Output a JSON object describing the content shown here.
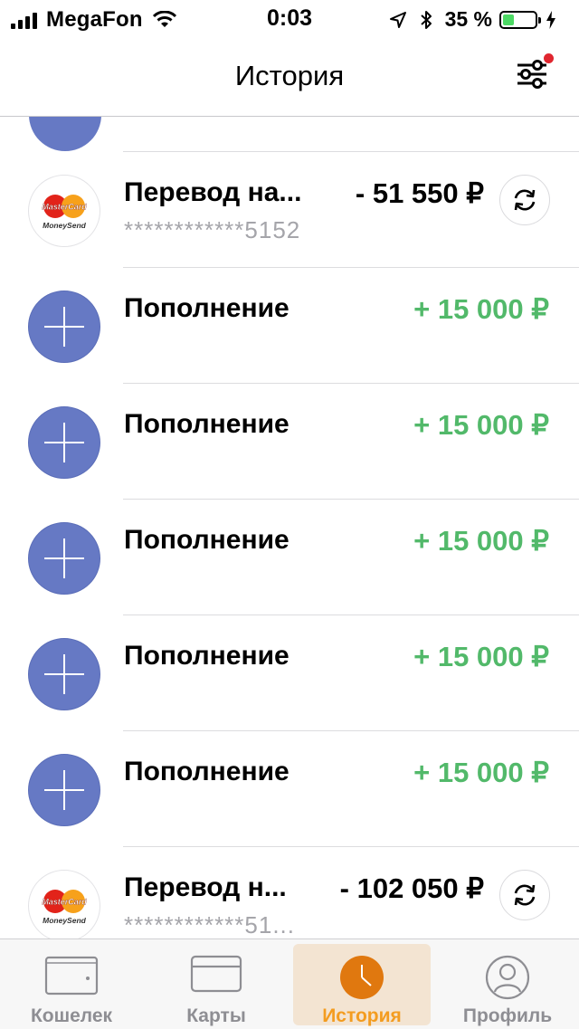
{
  "status_bar": {
    "carrier": "MegaFon",
    "time": "0:03",
    "battery_percent": "35 %",
    "battery_level": 0.35
  },
  "navbar": {
    "title": "История"
  },
  "transactions": [
    {
      "type": "transfer",
      "title": "Перевод на...",
      "subtitle": "************5152",
      "amount": "- 51 550 ₽"
    },
    {
      "type": "topup",
      "title": "Пополнение",
      "amount": "+ 15 000 ₽"
    },
    {
      "type": "topup",
      "title": "Пополнение",
      "amount": "+ 15 000 ₽"
    },
    {
      "type": "topup",
      "title": "Пополнение",
      "amount": "+ 15 000 ₽"
    },
    {
      "type": "topup",
      "title": "Пополнение",
      "amount": "+ 15 000 ₽"
    },
    {
      "type": "topup",
      "title": "Пополнение",
      "amount": "+ 15 000 ₽"
    },
    {
      "type": "transfer",
      "title": "Перевод н...",
      "subtitle": "************51...",
      "amount": "- 102 050 ₽"
    }
  ],
  "mastercard_logo": {
    "brand": "MasterCard",
    "sub": "MoneySend"
  },
  "tabs": [
    {
      "label": "Кошелек",
      "icon": "wallet-icon",
      "active": false
    },
    {
      "label": "Карты",
      "icon": "card-icon",
      "active": false
    },
    {
      "label": "История",
      "icon": "clock-icon",
      "active": true
    },
    {
      "label": "Профиль",
      "icon": "profile-icon",
      "active": false
    }
  ],
  "colors": {
    "accent": "#f39c20",
    "positive": "#52b96a",
    "avatar_blue": "#6679c4",
    "notification_dot": "#e0262f"
  }
}
